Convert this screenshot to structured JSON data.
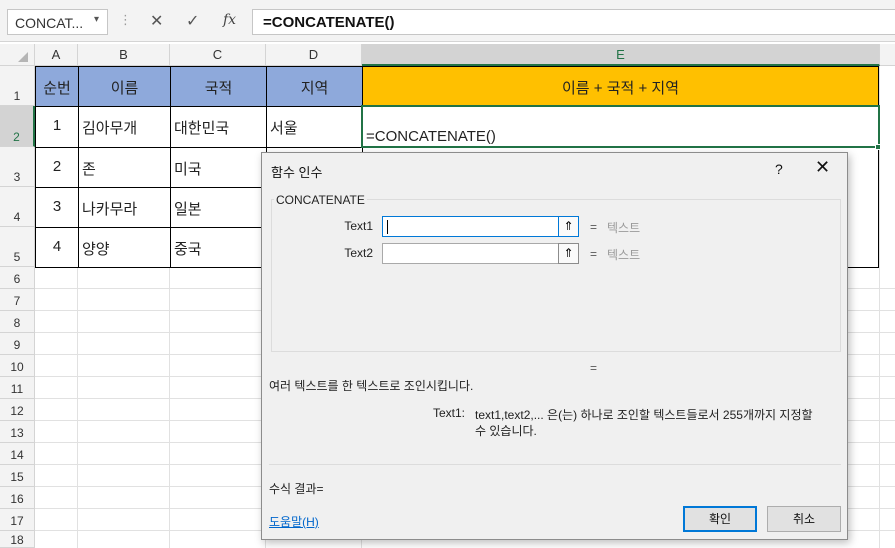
{
  "formula_bar": {
    "name_box": "CONCAT...",
    "name_box_arrow": "▾",
    "separator": "⋮",
    "cancel_icon": "✕",
    "enter_icon": "✓",
    "fx_label": "fx",
    "formula": "=CONCATENATE()"
  },
  "sheet": {
    "columns": [
      "A",
      "B",
      "C",
      "D",
      "E"
    ],
    "selected_column": "E",
    "rows": [
      "1",
      "2",
      "3",
      "4",
      "5",
      "6",
      "7",
      "8",
      "9",
      "10",
      "11",
      "12",
      "13",
      "14",
      "15",
      "16",
      "17",
      "18"
    ],
    "header": [
      "순번",
      "이름",
      "국적",
      "지역",
      "이름 + 국적 + 지역"
    ],
    "data": [
      [
        "1",
        "김아무개",
        "대한민국",
        "서울"
      ],
      [
        "2",
        "존",
        "미국",
        ""
      ],
      [
        "3",
        "나카무라",
        "일본",
        ""
      ],
      [
        "4",
        "양양",
        "중국",
        ""
      ]
    ],
    "active_cell_text": "=CONCATENATE()"
  },
  "dialog": {
    "title": "함수 인수",
    "help_icon": "?",
    "close_icon": "✕",
    "function_name": "CONCATENATE",
    "args": [
      {
        "label": "Text1",
        "value": "",
        "result": "텍스트"
      },
      {
        "label": "Text2",
        "value": "",
        "result": "텍스트"
      }
    ],
    "equals": "=",
    "result_eq": "=",
    "ref_icon": "⇑",
    "description": "여러 텍스트를 한 텍스트로 조인시킵니다.",
    "arg_desc_label": "Text1:",
    "arg_desc_line1": "text1,text2,... 은(는) 하나로 조인할 텍스트들로서 255개까지 지정할",
    "arg_desc_line2": "수 있습니다.",
    "formula_result": "수식 결과=",
    "help_link": "도움말(H)",
    "ok_label": "확인",
    "cancel_label": "취소"
  }
}
